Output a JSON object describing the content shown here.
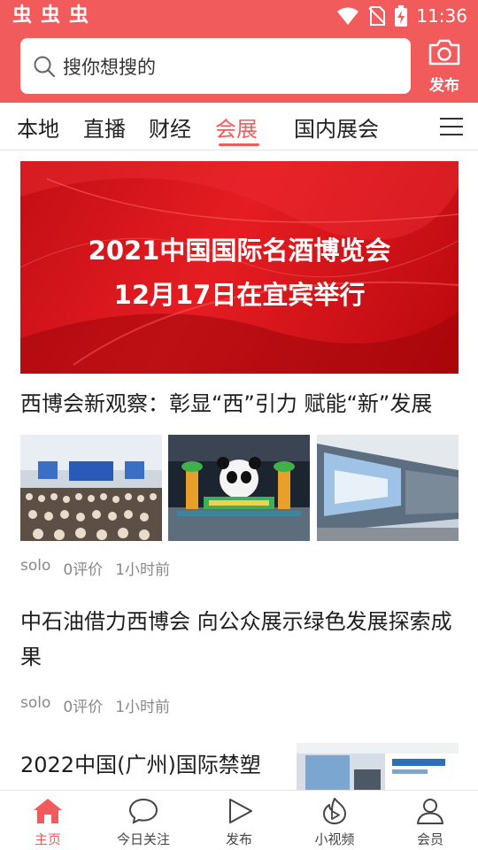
{
  "status_bar": {
    "app_glyphs": [
      "虫",
      "虫",
      "虫"
    ],
    "time": "11:36",
    "icons": [
      "wifi-icon",
      "no-sim-icon",
      "battery-charging-icon"
    ]
  },
  "header": {
    "search_placeholder": "搜你想搜的",
    "search_icon": "search-icon",
    "publish_label": "发布",
    "publish_icon": "camera-icon"
  },
  "tabs": {
    "items": [
      "本地",
      "直播",
      "财经",
      "会展",
      "国内展会"
    ],
    "active": "会展",
    "more_icon": "menu-icon"
  },
  "banner": {
    "line1": "2021中国国际名酒博览会",
    "line2": "12月17日在宜宾举行"
  },
  "articles": [
    {
      "title": "西博会新观察：彰显“西”引力 赋能“新”发展",
      "author": "solo",
      "comments": "0评价",
      "time": "1小时前"
    },
    {
      "title": "中石油借力西博会 向公众展示绿色发展探索成果",
      "author": "solo",
      "comments": "0评价",
      "time": "1小时前"
    },
    {
      "title": "2022中国(广州)国际禁塑"
    }
  ],
  "bottom_nav": {
    "items": [
      {
        "label": "主页",
        "icon": "home-icon"
      },
      {
        "label": "今日关注",
        "icon": "chat-bubble-icon"
      },
      {
        "label": "发布",
        "icon": "play-triangle-icon"
      },
      {
        "label": "小视频",
        "icon": "video-flame-icon"
      },
      {
        "label": "会员",
        "icon": "user-icon"
      }
    ],
    "active": "主页"
  },
  "colors": {
    "brand": "#f25b5b",
    "banner_red": "#d8141a",
    "text": "#1e1e1e",
    "meta": "#888888"
  }
}
